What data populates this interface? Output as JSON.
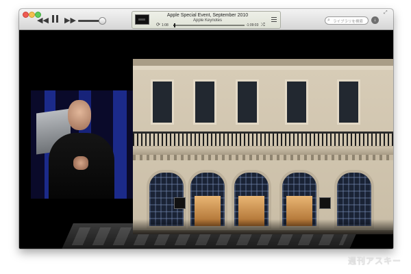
{
  "window": {
    "controls": [
      "close",
      "minimize",
      "zoom"
    ]
  },
  "toolbar": {
    "transport": {
      "rewind_icon": "rewind-icon",
      "pause_icon": "pause-icon",
      "fast_forward_icon": "fast-forward-icon",
      "rewind_glyph": "◀◀",
      "fast_forward_glyph": "▶▶"
    },
    "volume": {
      "level": 0.85
    },
    "now_playing": {
      "title": "Apple Special Event, September 2010",
      "subtitle": "Apple Keynotes",
      "elapsed": "1:08",
      "remaining": "-1:09:03",
      "progress": 0.02,
      "repeat_icon": "⟳",
      "shuffle_icon": "⤮",
      "thumbnail": "video-thumbnail"
    },
    "search": {
      "placeholder": "ライブラリを検索",
      "icon": "⌕"
    },
    "download_icon": "↓",
    "fullscreen_icon": "⤢"
  },
  "video": {
    "description": "keynote-video",
    "store_logo": ""
  },
  "watermark": {
    "text": "週刊アスキー"
  }
}
